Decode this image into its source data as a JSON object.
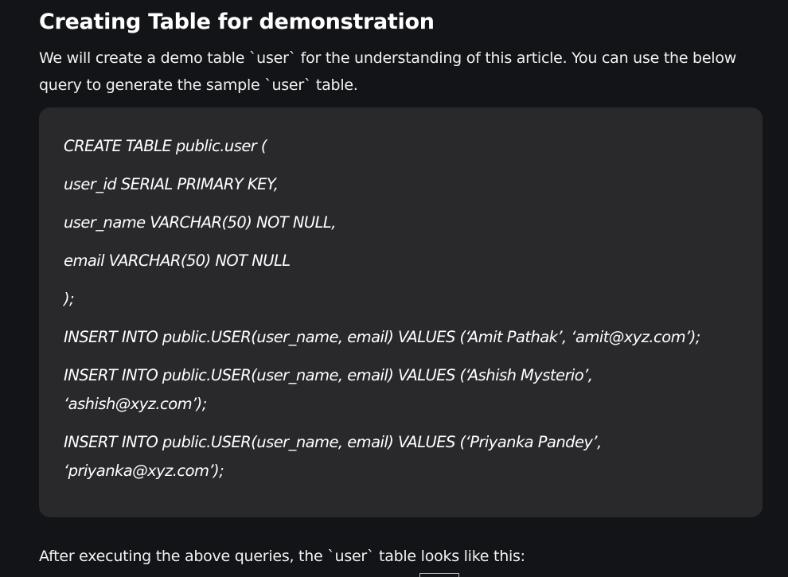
{
  "article": {
    "heading": "Creating Table for demonstration",
    "intro": "We will create a demo table `user` for the understanding of this article. You can use the below query to generate the sample `user` table.",
    "code_lines": [
      "CREATE TABLE public.user (",
      "user_id SERIAL PRIMARY KEY,",
      "user_name VARCHAR(50) NOT NULL,",
      "email VARCHAR(50) NOT NULL",
      ");",
      "INSERT INTO public.USER(user_name, email) VALUES (‘Amit Pathak’, ‘amit@xyz.com’);",
      "INSERT INTO public.USER(user_name, email) VALUES (‘Ashish Mysterio’,",
      "‘ashish@xyz.com’);",
      "INSERT INTO public.USER(user_name, email) VALUES (‘Priyanka Pandey’,",
      "‘priyanka@xyz.com’);"
    ],
    "outro": "After executing the above queries, the `user` table looks like this:"
  }
}
